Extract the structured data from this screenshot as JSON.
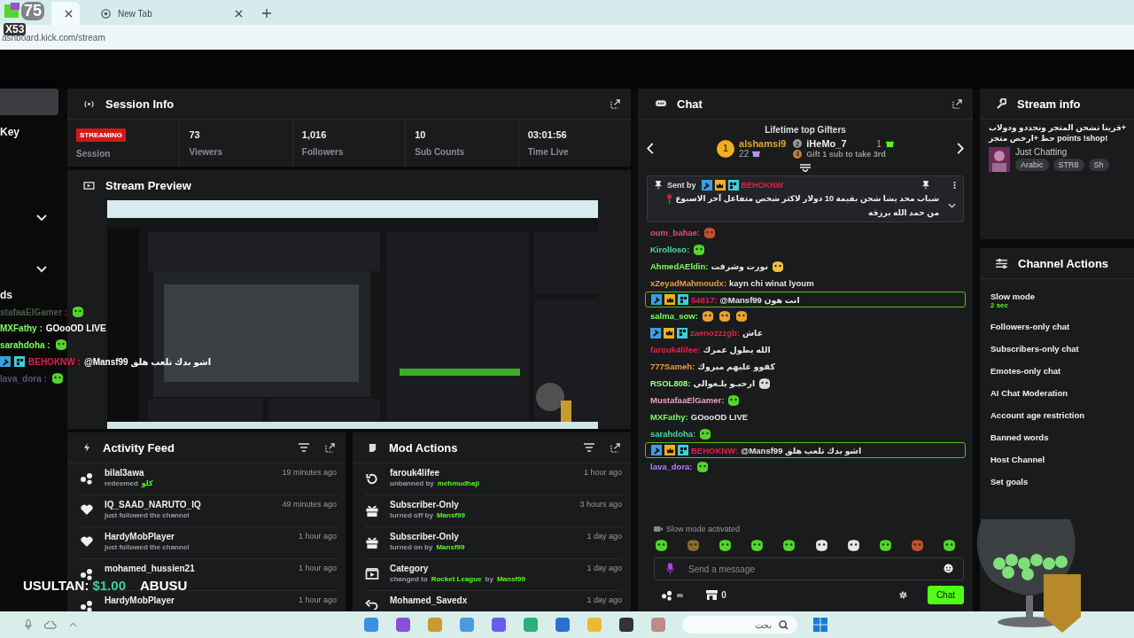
{
  "browser": {
    "tabs": [
      {
        "selected": true
      },
      {
        "title": "New Tab",
        "selected": false
      }
    ],
    "url": "ashboard.kick.com/stream"
  },
  "sidebar": {
    "items": [
      {
        "kind": "block",
        "selected": true
      },
      {
        "kind": "label",
        "label": "Key",
        "selected": false
      },
      {
        "kind": "chevron"
      },
      {
        "kind": "chevron"
      },
      {
        "kind": "label",
        "label": "ds",
        "selected": false
      }
    ]
  },
  "session_info": {
    "title": "Session Info",
    "status": "STREAMING",
    "status_label": "Session",
    "stats": [
      {
        "value": "73",
        "label": "Viewers"
      },
      {
        "value": "1,016",
        "label": "Followers"
      },
      {
        "value": "10",
        "label": "Sub Counts"
      },
      {
        "value": "03:01:56",
        "label": "Time Live"
      }
    ]
  },
  "stream_preview": {
    "title": "Stream Preview",
    "kind": "picture"
  },
  "activity_feed": {
    "title": "Activity Feed",
    "items": [
      {
        "kind": "points",
        "name": "bilal3awa",
        "time": "19 minutes ago",
        "detail": [
          {
            "text": "redeemed",
            "highlight": false
          },
          {
            "text": "كلو",
            "highlight": true
          }
        ]
      },
      {
        "kind": "heart",
        "name": "IQ_SAAD_NARUTO_IQ",
        "time": "49 minutes ago",
        "detail": [
          {
            "text": "just followed the channel",
            "highlight": false
          }
        ]
      },
      {
        "kind": "heart",
        "name": "HardyMobPlayer",
        "time": "1 hour ago",
        "detail": [
          {
            "text": "just followed the channel",
            "highlight": false
          }
        ]
      },
      {
        "kind": "points",
        "name": "mohamed_hussien21",
        "time": "1 hour ago"
      },
      {
        "kind": "points",
        "name": "HardyMobPlayer",
        "time": "1 hour ago"
      }
    ]
  },
  "mod_actions": {
    "title": "Mod Actions",
    "items": [
      {
        "kind": "unban",
        "name": "farouk4lifee",
        "time": "1 hour ago",
        "detail": [
          {
            "text": "unbanned by",
            "highlight": false
          },
          {
            "text": "mehmudhaji",
            "highlight": true
          }
        ]
      },
      {
        "kind": "gift",
        "name": "Subscriber-Only",
        "time": "3 hours ago",
        "detail": [
          {
            "text": "turned off by",
            "highlight": false
          },
          {
            "text": "Mansf99",
            "highlight": true
          }
        ]
      },
      {
        "kind": "gift",
        "name": "Subscriber-Only",
        "time": "1 day ago",
        "detail": [
          {
            "text": "turned on by",
            "highlight": false
          },
          {
            "text": "Mansf99",
            "highlight": true
          }
        ]
      },
      {
        "kind": "category",
        "name": "Category",
        "time": "1 day ago",
        "detail": [
          {
            "text": "changed to",
            "highlight": false
          },
          {
            "text": "Rocket League",
            "highlight": true
          },
          {
            "text": "by",
            "highlight": false
          },
          {
            "text": "Mansf99",
            "highlight": true
          }
        ]
      },
      {
        "kind": "undo",
        "name": "Mohamed_Savedx",
        "time": "1 day ago"
      }
    ]
  },
  "chat": {
    "title": "Chat",
    "gifters": {
      "title": "Lifetime top Gifters",
      "entries": [
        {
          "rank": "1",
          "name": "alshamsi9",
          "count": "22"
        },
        {
          "rank": "2",
          "name": "iHeMo_7",
          "count": "1"
        },
        {
          "rank": "3",
          "note": "Gift 1 sub to take 3rd"
        }
      ]
    },
    "pinned": {
      "label": "Sent by",
      "user": "BEHOKNW",
      "text": "شباب محد يشا شحن بقيمة 10 دولار لاكثر شخص متفاعل آخر الاسبوع",
      "text_2": "من حمد الله برزقه"
    },
    "messages": [
      {
        "user": "oum_bahae:",
        "color": "#e0507a",
        "badges": false,
        "highlighted": false,
        "emotes": [
          {
            "kind": "redface"
          }
        ]
      },
      {
        "user": "Kirolloso:",
        "color": "#4dd9a0",
        "badges": false,
        "highlighted": false,
        "emotes": [
          {
            "kind": "blob"
          }
        ]
      },
      {
        "user": "AhmedAEldin:",
        "color": "#7dff5a",
        "badges": false,
        "highlighted": false,
        "text": "نورت وشرفت",
        "emotes": [
          {
            "kind": "hands"
          }
        ]
      },
      {
        "user": "xZeyadMahmoudx:",
        "color": "#e8a040",
        "badges": false,
        "highlighted": false,
        "text": "kayn chi winat lyoum"
      },
      {
        "user": "54817:",
        "color": "#e0204a",
        "badges": true,
        "highlighted": true,
        "text": "@Mansf99 انت هون"
      },
      {
        "user": "salma_sow:",
        "color": "#7dff5a",
        "badges": false,
        "highlighted": false,
        "emotes": [
          {
            "kind": "laugh"
          },
          {
            "kind": "laugh"
          },
          {
            "kind": "laugh"
          }
        ]
      },
      {
        "user": "zaenozzzgb:",
        "color": "#e0204a",
        "badges": true,
        "highlighted": false,
        "text": "عاش"
      },
      {
        "user": "farouk4lifee:",
        "color": "#e0204a",
        "badges": false,
        "highlighted": false,
        "text": "الله يطول عمرك"
      },
      {
        "user": "777Sameh:",
        "color": "#e8a040",
        "badges": false,
        "highlighted": false,
        "text": "كفوو عليهم مبروك"
      },
      {
        "user": "RSOL808:",
        "color": "#a0ff80",
        "badges": false,
        "highlighted": false,
        "text": "ارحبـو يلـغوالي",
        "emotes": [
          {
            "kind": "skull"
          }
        ]
      },
      {
        "user": "MustafaaElGamer:",
        "color": "#f0a0c0",
        "badges": false,
        "highlighted": false,
        "emotes": [
          {
            "kind": "blob"
          }
        ]
      },
      {
        "user": "MXFathy:",
        "color": "#7dff5a",
        "badges": false,
        "highlighted": false,
        "text": "GOooOD LIVE"
      },
      {
        "user": "sarahdoha:",
        "color": "#4dd9a0",
        "badges": false,
        "highlighted": false,
        "emotes": [
          {
            "kind": "blob"
          }
        ]
      },
      {
        "user": "BEHOKNW:",
        "color": "#e0204a",
        "badges": true,
        "highlighted": true,
        "text": "@Mansf99 اشو بدك تلعب هلق"
      },
      {
        "user": "lava_dora:",
        "color": "#b080ff",
        "badges": false,
        "highlighted": false,
        "emotes": [
          {
            "kind": "blob"
          }
        ]
      }
    ],
    "notice": "Slow mode activated",
    "emote_bar": [
      {
        "kind": "blob"
      },
      {
        "kind": "box"
      },
      {
        "kind": "hearteyes"
      },
      {
        "kind": "grin"
      },
      {
        "kind": "blob"
      },
      {
        "kind": "headphones"
      },
      {
        "kind": "headphones"
      },
      {
        "kind": "blob"
      },
      {
        "kind": "redface"
      },
      {
        "kind": "blob"
      }
    ],
    "input": {
      "placeholder": "Send a message"
    },
    "points": "∞",
    "store_count": "0",
    "send_button": "Chat"
  },
  "stream_info": {
    "title": "Stream info",
    "stream_title": [
      "+قرينا تشحن المتجر ونجددو ودولاب",
      "!points !shop حظ +ارخص متجر"
    ],
    "category": "Just Chatting",
    "tags": [
      "Arabic",
      "STR8",
      "Sh"
    ]
  },
  "channel_actions": {
    "title": "Channel Actions",
    "items": [
      {
        "label": "Slow mode",
        "value": "2 sec"
      },
      {
        "label": "Followers-only chat"
      },
      {
        "label": "Subscribers-only chat"
      },
      {
        "label": "Emotes-only chat"
      },
      {
        "label": "AI Chat Moderation"
      },
      {
        "label": "Account age restriction"
      },
      {
        "label": "Banned words"
      },
      {
        "label": "Host Channel"
      },
      {
        "label": "Set goals"
      }
    ]
  },
  "stream_overlay": {
    "counter": "75",
    "multiplier": "X53",
    "chat": [
      {
        "user": "stafaaElGamer :",
        "color": "#4a5a4a",
        "badges": false,
        "emote": {
          "kind": "blob"
        }
      },
      {
        "user": "MXFathy :",
        "color": "#7dff5a",
        "badges": false,
        "text": "GOooOD LIVE"
      },
      {
        "user": "sarahdoha :",
        "color": "#7dff5a",
        "badges": false,
        "emote": {
          "kind": "blob"
        }
      },
      {
        "user": "BEHOKNW :",
        "color": "#e0204a",
        "badges": true,
        "text": "@Mansf99 اشو بدك تلعب هلق"
      },
      {
        "user": "lava_dora :",
        "color": "#55557a",
        "badges": false,
        "emote": {
          "kind": "blob"
        }
      }
    ],
    "ticker": [
      {
        "kind": "name",
        "text": "USULTAN:"
      },
      {
        "kind": "amount",
        "text": "$1.00"
      },
      {
        "kind": "name",
        "text": "ABUSU"
      }
    ]
  },
  "taskbar": {
    "search_placeholder": "بحث"
  }
}
